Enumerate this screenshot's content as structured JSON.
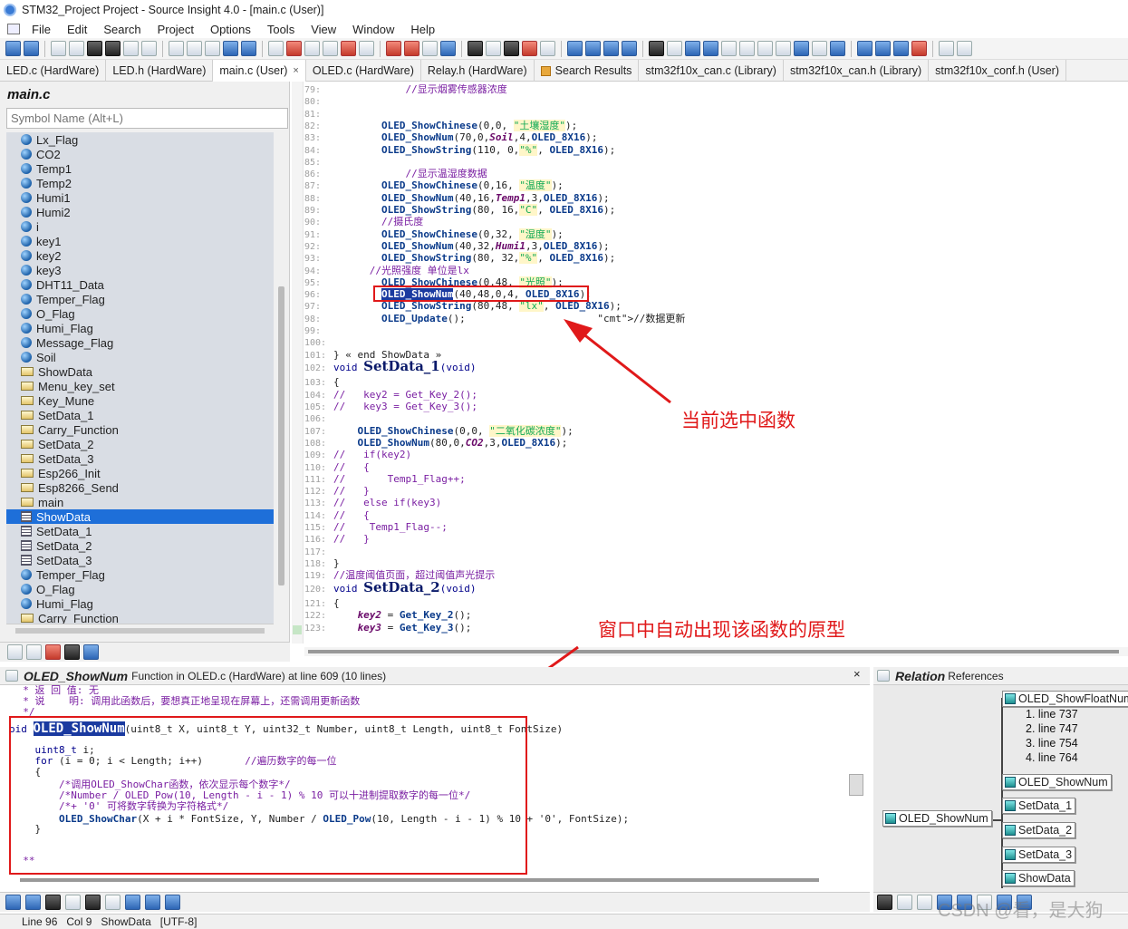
{
  "window": {
    "title": "STM32_Project Project - Source Insight 4.0 - [main.c (User)]"
  },
  "menu": [
    "File",
    "Edit",
    "Search",
    "Project",
    "Options",
    "Tools",
    "View",
    "Window",
    "Help"
  ],
  "tabs": [
    {
      "label": "LED.c (HardWare)"
    },
    {
      "label": "LED.h (HardWare)"
    },
    {
      "label": "main.c (User)",
      "close": "×"
    },
    {
      "label": "OLED.c (HardWare)"
    },
    {
      "label": "Relay.h (HardWare)"
    },
    {
      "label": "Search Results"
    },
    {
      "label": "stm32f10x_can.c (Library)"
    },
    {
      "label": "stm32f10x_can.h (Library)"
    },
    {
      "label": "stm32f10x_conf.h (User)"
    }
  ],
  "symbol_panel": {
    "file_title": "main.c",
    "search_placeholder": "Symbol Name (Alt+L)",
    "symbols": [
      {
        "name": "Lx_Flag",
        "kind": "var"
      },
      {
        "name": "CO2",
        "kind": "var"
      },
      {
        "name": "Temp1",
        "kind": "var"
      },
      {
        "name": "Temp2",
        "kind": "var"
      },
      {
        "name": "Humi1",
        "kind": "var"
      },
      {
        "name": "Humi2",
        "kind": "var"
      },
      {
        "name": "i",
        "kind": "var"
      },
      {
        "name": "key1",
        "kind": "var"
      },
      {
        "name": "key2",
        "kind": "var"
      },
      {
        "name": "key3",
        "kind": "var"
      },
      {
        "name": "DHT11_Data",
        "kind": "var"
      },
      {
        "name": "Temper_Flag",
        "kind": "var"
      },
      {
        "name": "O_Flag",
        "kind": "var"
      },
      {
        "name": "Humi_Flag",
        "kind": "var"
      },
      {
        "name": "Message_Flag",
        "kind": "var"
      },
      {
        "name": "Soil",
        "kind": "var"
      },
      {
        "name": "ShowData",
        "kind": "func"
      },
      {
        "name": "Menu_key_set",
        "kind": "func"
      },
      {
        "name": "Key_Mune",
        "kind": "func"
      },
      {
        "name": "SetData_1",
        "kind": "func"
      },
      {
        "name": "Carry_Function",
        "kind": "func"
      },
      {
        "name": "SetData_2",
        "kind": "func"
      },
      {
        "name": "SetData_3",
        "kind": "func"
      },
      {
        "name": "Esp266_Init",
        "kind": "func"
      },
      {
        "name": "Esp8266_Send",
        "kind": "func"
      },
      {
        "name": "main",
        "kind": "func"
      },
      {
        "name": "ShowData",
        "kind": "proto",
        "selected": true
      },
      {
        "name": "SetData_1",
        "kind": "proto"
      },
      {
        "name": "SetData_2",
        "kind": "proto"
      },
      {
        "name": "SetData_3",
        "kind": "proto"
      },
      {
        "name": "Temper_Flag",
        "kind": "var"
      },
      {
        "name": "O_Flag",
        "kind": "var"
      },
      {
        "name": "Humi_Flag",
        "kind": "var"
      },
      {
        "name": "Carry_Function",
        "kind": "func"
      }
    ]
  },
  "editor": {
    "lines": [
      {
        "n": "79:",
        "code": "            //显示烟雾传感器浓度",
        "type": "cmt"
      },
      {
        "n": "80:",
        "code": ""
      },
      {
        "n": "81:",
        "code": ""
      },
      {
        "n": "82:",
        "code": "        OLED_ShowChinese(0,0, \"土壤湿度\");"
      },
      {
        "n": "83:",
        "code": "        OLED_ShowNum(70,0,Soil,4,OLED_8X16);"
      },
      {
        "n": "84:",
        "code": "        OLED_ShowString(110, 0,\"%\", OLED_8X16);"
      },
      {
        "n": "85:",
        "code": ""
      },
      {
        "n": "86:",
        "code": "            //显示温湿度数据",
        "type": "cmt"
      },
      {
        "n": "87:",
        "code": "        OLED_ShowChinese(0,16, \"温度\");"
      },
      {
        "n": "88:",
        "code": "        OLED_ShowNum(40,16,Temp1,3,OLED_8X16);"
      },
      {
        "n": "89:",
        "code": "        OLED_ShowString(80, 16,\"C\", OLED_8X16);"
      },
      {
        "n": "90:",
        "code": "        //摄氏度",
        "type": "cmt"
      },
      {
        "n": "91:",
        "code": "        OLED_ShowChinese(0,32, \"湿度\");"
      },
      {
        "n": "92:",
        "code": "        OLED_ShowNum(40,32,Humi1,3,OLED_8X16);"
      },
      {
        "n": "93:",
        "code": "        OLED_ShowString(80, 32,\"%\", OLED_8X16);"
      },
      {
        "n": "94:",
        "code": "      //光照强度 单位是lx",
        "type": "cmt"
      },
      {
        "n": "95:",
        "code": "        OLED_ShowChinese(0,48, \"光照\");"
      },
      {
        "n": "96:",
        "code": "        OLED_ShowNum(40,48,0,4, OLED_8X16);",
        "selected": true
      },
      {
        "n": "97:",
        "code": "        OLED_ShowString(80,48, \"lx\", OLED_8X16);"
      },
      {
        "n": "98:",
        "code": "        OLED_Update();                      //数据更新"
      },
      {
        "n": "99:",
        "code": ""
      },
      {
        "n": "100:",
        "code": ""
      },
      {
        "n": "101:",
        "code": "} « end ShowData »"
      },
      {
        "n": "102:",
        "code": "void SetData_1(void)",
        "big": true
      },
      {
        "n": "103:",
        "code": "{"
      },
      {
        "n": "104:",
        "code": "//   key2 = Get_Key_2();",
        "type": "cmt"
      },
      {
        "n": "105:",
        "code": "//   key3 = Get_Key_3();",
        "type": "cmt"
      },
      {
        "n": "106:",
        "code": ""
      },
      {
        "n": "107:",
        "code": "    OLED_ShowChinese(0,0, \"二氧化碳浓度\");"
      },
      {
        "n": "108:",
        "code": "    OLED_ShowNum(80,0,CO2,3,OLED_8X16);"
      },
      {
        "n": "109:",
        "code": "//   if(key2)",
        "type": "cmt"
      },
      {
        "n": "110:",
        "code": "//   {",
        "type": "cmt"
      },
      {
        "n": "111:",
        "code": "//       Temp1_Flag++;",
        "type": "cmt"
      },
      {
        "n": "112:",
        "code": "//   }",
        "type": "cmt"
      },
      {
        "n": "113:",
        "code": "//   else if(key3)",
        "type": "cmt"
      },
      {
        "n": "114:",
        "code": "//   {",
        "type": "cmt"
      },
      {
        "n": "115:",
        "code": "//    Temp1_Flag--;",
        "type": "cmt"
      },
      {
        "n": "116:",
        "code": "//   }",
        "type": "cmt"
      },
      {
        "n": "117:",
        "code": ""
      },
      {
        "n": "118:",
        "code": "}"
      },
      {
        "n": "119:",
        "code": "//温度阈值页面，超过阈值声光提示",
        "type": "cmt"
      },
      {
        "n": "120:",
        "code": "void SetData_2(void)",
        "big": true
      },
      {
        "n": "121:",
        "code": "{"
      },
      {
        "n": "122:",
        "code": "    key2 = Get_Key_2();"
      },
      {
        "n": "123:",
        "code": "    key3 = Get_Key_3();"
      }
    ]
  },
  "annotations": {
    "current_function": "当前选中函数",
    "prototype_window": "窗口中自动出现该函数的原型"
  },
  "context_window": {
    "func_name": "OLED_ShowNum",
    "info": "Function in OLED.c (HardWare) at line 609 (10 lines)",
    "close": "×",
    "lines": [
      "  * 返 回 值: 无",
      "  * 说    明: 调用此函数后，要想真正地呈现在屏幕上，还需调用更新函数",
      "  */",
      "oid OLED_ShowNum(uint8_t X, uint8_t Y, uint32_t Number, uint8_t Length, uint8_t FontSize)",
      "",
      "    uint8_t i;",
      "    for (i = 0; i < Length; i++)       //遍历数字的每一位",
      "    {",
      "        /*调用OLED_ShowChar函数，依次显示每个数字*/",
      "        /*Number / OLED_Pow(10, Length - i - 1) % 10 可以十进制提取数字的每一位*/",
      "        /*+ '0' 可将数字转换为字符格式*/",
      "        OLED_ShowChar(X + i * FontSize, Y, Number / OLED_Pow(10, Length - i - 1) % 10 + '0', FontSize);",
      "    }",
      "",
      "",
      "  **"
    ]
  },
  "relation_window": {
    "title": "Relation",
    "subtitle": "References",
    "root": "OLED_ShowNum",
    "callers": [
      {
        "name": "OLED_ShowFloatNum",
        "refs": [
          "1. line 737",
          "2. line 747",
          "3. line 754",
          "4. line 764"
        ]
      },
      {
        "name": "OLED_ShowNum"
      },
      {
        "name": "SetData_1"
      },
      {
        "name": "SetData_2"
      },
      {
        "name": "SetData_3"
      },
      {
        "name": "ShowData"
      }
    ]
  },
  "status": {
    "line": "Line 96",
    "col": "Col 9",
    "func": "ShowData",
    "enc": "[UTF-8]"
  },
  "watermark": "CSDN @看，是大狗"
}
